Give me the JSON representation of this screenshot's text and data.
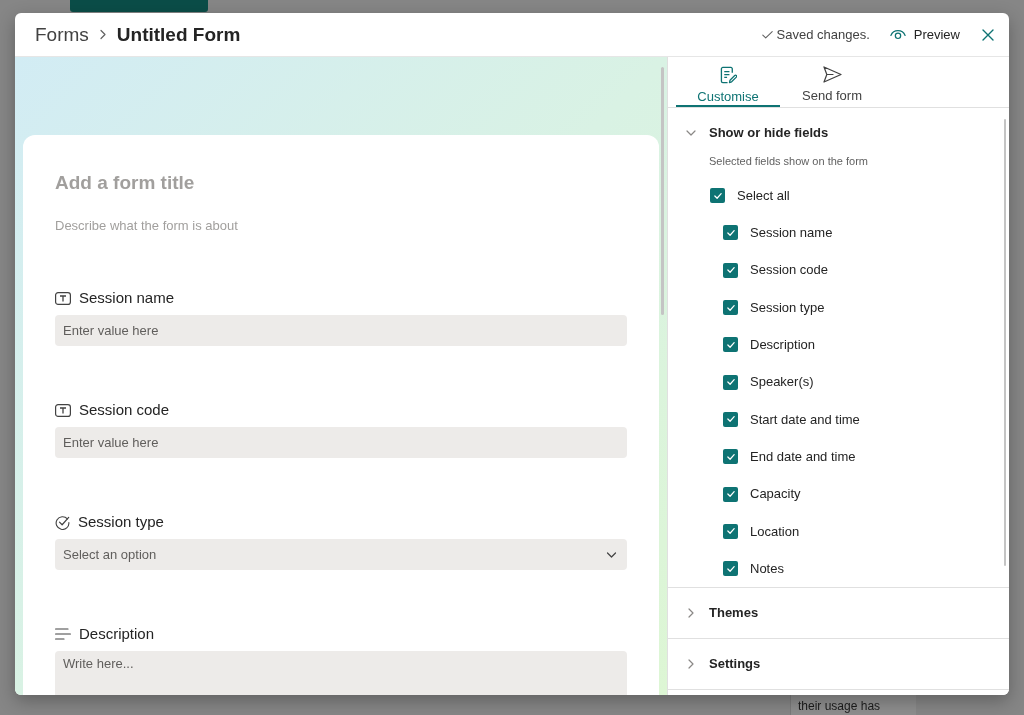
{
  "background": {
    "table_cell": "their usage has"
  },
  "dialog": {
    "breadcrumb": [
      {
        "label": "Forms"
      },
      {
        "label": "Untitled Form"
      }
    ],
    "status": "Saved changes.",
    "preview": "Preview"
  },
  "form": {
    "title_placeholder": "Add a form title",
    "description_placeholder": "Describe what the form is about",
    "fields": [
      {
        "kind": "text",
        "label": "Session name",
        "placeholder": "Enter value here"
      },
      {
        "kind": "text",
        "label": "Session code",
        "placeholder": "Enter value here"
      },
      {
        "kind": "choice",
        "label": "Session type",
        "placeholder": "Select an option"
      },
      {
        "kind": "multiline",
        "label": "Description",
        "placeholder": "Write here..."
      }
    ]
  },
  "panel": {
    "tabs": [
      {
        "label": "Customise",
        "selected": true
      },
      {
        "label": "Send form",
        "selected": false
      }
    ],
    "sections": [
      {
        "title": "Show or hide fields",
        "expanded": true,
        "hint": "Selected fields show on the form",
        "select_all": {
          "label": "Select all",
          "checked": true
        },
        "items": [
          {
            "label": "Session name",
            "checked": true
          },
          {
            "label": "Session code",
            "checked": true
          },
          {
            "label": "Session type",
            "checked": true
          },
          {
            "label": "Description",
            "checked": true
          },
          {
            "label": "Speaker(s)",
            "checked": true
          },
          {
            "label": "Start date and time",
            "checked": true
          },
          {
            "label": "End date and time",
            "checked": true
          },
          {
            "label": "Capacity",
            "checked": true
          },
          {
            "label": "Location",
            "checked": true
          },
          {
            "label": "Notes",
            "checked": true
          }
        ]
      },
      {
        "title": "Themes",
        "expanded": false
      },
      {
        "title": "Settings",
        "expanded": false
      }
    ]
  }
}
